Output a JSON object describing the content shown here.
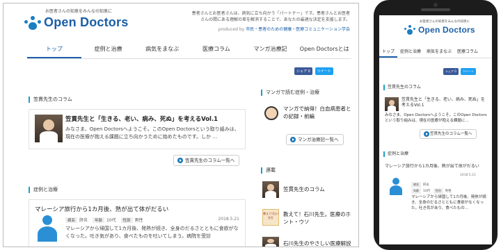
{
  "desktop": {
    "logo": {
      "tagline": "お医者さんの知恵をみんなの知恵に",
      "name": "Open Doctors"
    },
    "header_desc": "患者さんとお医者さんは、病気に立ち向かう「パートナー」です。患者さんとお医者さんの間にある理解の差を解消することで、あなたの最適な決定を支援します。",
    "produced_prefix": "produced by",
    "produced_org": "市民・患者のための健康・医療コミュニケーション学会",
    "nav": [
      "トップ",
      "症例と治療",
      "病気をまなぶ",
      "医療コラム",
      "マンガ治療記",
      "Open Doctorsとは"
    ],
    "share": {
      "facebook": "シェア 0",
      "twitter": "ツイート"
    },
    "column_section": "笠貫先生のコラム",
    "column_title": "笠貫先生と「生きる、老い、病み、死ぬ」を考えるVol.1",
    "column_body": "みなさま、Open Doctorsへようこそ。このOpen Doctorsという取り組みは、現在の医療が抱える課題に立ち向かうために始めたものです。しか …",
    "column_more": "笠貫先生のコラム一覧へ",
    "case_section": "症例と治療",
    "case_title": "マレーシア旅行から1カ月後、熱が出て体がだるい",
    "case_date": "2018.5.21",
    "case_tags": {
      "disease_label": "病名",
      "disease": "肝炎",
      "age_label": "年齢",
      "age": "10代",
      "sex_label": "性別",
      "sex": "男性"
    },
    "case_body": "マレーシアから帰国して1カ月後、発熱が続き、全身のだるさとともに食欲がなくなった。吐き気があり、食べたものを吐いてしまう。病院を受診",
    "manga_section": "マンガで読む症例・治療",
    "manga_title": "マンガで納得！白血病患者との記録・前編",
    "manga_more": "マンガ治療記一覧へ",
    "series_section": "連載",
    "series_items": [
      "笠貫先生のコラム",
      "教えて！石川先生。医療のホント・ウソ",
      "石川先生のやさしい医療解説"
    ],
    "series_thumb_text": "教えて!石川先生"
  },
  "phone": {
    "nav": [
      "トップ",
      "症例と治療",
      "病気をまなぶ",
      "医療コラム"
    ],
    "share": {
      "facebook": "シェア 0",
      "twitter": "ツイート"
    },
    "column_section": "笠貫先生のコラム",
    "column_title": "笠貫先生と「生きる、老い、病み、死ぬ」を考えるVol.1",
    "column_body": "みなさま、Open Doctorsへようこそ。このOpen Doctorsという取り組みは、現在の医療が抱える課題に…",
    "column_more": "笠貫先生のコラム一覧へ",
    "case_section": "症例と治療",
    "case_title": "マレーシア旅行から1カ月後、熱が出て体がだるい",
    "case_date": "2018.5.21",
    "case_body": "マレーシアから帰国して1カ月後、発熱が続き、全身のだるさとともに食欲がなくなった。吐き気があり、食べたもの…"
  },
  "colors": {
    "brand": "#1b5fa8",
    "accent": "#1b9ec4",
    "icon": "#2b8fd6",
    "facebook": "#3b5998",
    "twitter": "#1da1f2"
  }
}
